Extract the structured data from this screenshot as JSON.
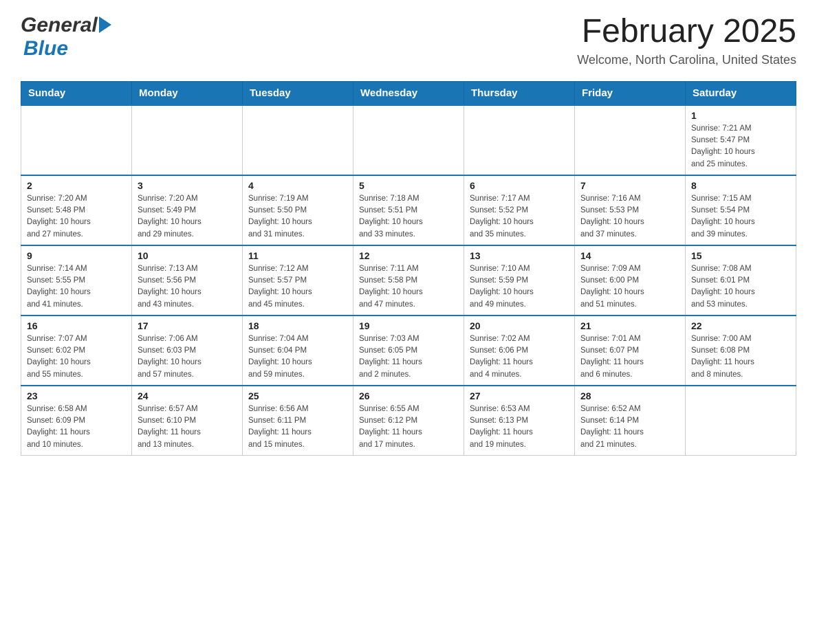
{
  "header": {
    "logo_general": "General",
    "logo_blue": "Blue",
    "title": "February 2025",
    "subtitle": "Welcome, North Carolina, United States"
  },
  "weekdays": [
    "Sunday",
    "Monday",
    "Tuesday",
    "Wednesday",
    "Thursday",
    "Friday",
    "Saturday"
  ],
  "weeks": [
    [
      {
        "day": "",
        "info": ""
      },
      {
        "day": "",
        "info": ""
      },
      {
        "day": "",
        "info": ""
      },
      {
        "day": "",
        "info": ""
      },
      {
        "day": "",
        "info": ""
      },
      {
        "day": "",
        "info": ""
      },
      {
        "day": "1",
        "info": "Sunrise: 7:21 AM\nSunset: 5:47 PM\nDaylight: 10 hours\nand 25 minutes."
      }
    ],
    [
      {
        "day": "2",
        "info": "Sunrise: 7:20 AM\nSunset: 5:48 PM\nDaylight: 10 hours\nand 27 minutes."
      },
      {
        "day": "3",
        "info": "Sunrise: 7:20 AM\nSunset: 5:49 PM\nDaylight: 10 hours\nand 29 minutes."
      },
      {
        "day": "4",
        "info": "Sunrise: 7:19 AM\nSunset: 5:50 PM\nDaylight: 10 hours\nand 31 minutes."
      },
      {
        "day": "5",
        "info": "Sunrise: 7:18 AM\nSunset: 5:51 PM\nDaylight: 10 hours\nand 33 minutes."
      },
      {
        "day": "6",
        "info": "Sunrise: 7:17 AM\nSunset: 5:52 PM\nDaylight: 10 hours\nand 35 minutes."
      },
      {
        "day": "7",
        "info": "Sunrise: 7:16 AM\nSunset: 5:53 PM\nDaylight: 10 hours\nand 37 minutes."
      },
      {
        "day": "8",
        "info": "Sunrise: 7:15 AM\nSunset: 5:54 PM\nDaylight: 10 hours\nand 39 minutes."
      }
    ],
    [
      {
        "day": "9",
        "info": "Sunrise: 7:14 AM\nSunset: 5:55 PM\nDaylight: 10 hours\nand 41 minutes."
      },
      {
        "day": "10",
        "info": "Sunrise: 7:13 AM\nSunset: 5:56 PM\nDaylight: 10 hours\nand 43 minutes."
      },
      {
        "day": "11",
        "info": "Sunrise: 7:12 AM\nSunset: 5:57 PM\nDaylight: 10 hours\nand 45 minutes."
      },
      {
        "day": "12",
        "info": "Sunrise: 7:11 AM\nSunset: 5:58 PM\nDaylight: 10 hours\nand 47 minutes."
      },
      {
        "day": "13",
        "info": "Sunrise: 7:10 AM\nSunset: 5:59 PM\nDaylight: 10 hours\nand 49 minutes."
      },
      {
        "day": "14",
        "info": "Sunrise: 7:09 AM\nSunset: 6:00 PM\nDaylight: 10 hours\nand 51 minutes."
      },
      {
        "day": "15",
        "info": "Sunrise: 7:08 AM\nSunset: 6:01 PM\nDaylight: 10 hours\nand 53 minutes."
      }
    ],
    [
      {
        "day": "16",
        "info": "Sunrise: 7:07 AM\nSunset: 6:02 PM\nDaylight: 10 hours\nand 55 minutes."
      },
      {
        "day": "17",
        "info": "Sunrise: 7:06 AM\nSunset: 6:03 PM\nDaylight: 10 hours\nand 57 minutes."
      },
      {
        "day": "18",
        "info": "Sunrise: 7:04 AM\nSunset: 6:04 PM\nDaylight: 10 hours\nand 59 minutes."
      },
      {
        "day": "19",
        "info": "Sunrise: 7:03 AM\nSunset: 6:05 PM\nDaylight: 11 hours\nand 2 minutes."
      },
      {
        "day": "20",
        "info": "Sunrise: 7:02 AM\nSunset: 6:06 PM\nDaylight: 11 hours\nand 4 minutes."
      },
      {
        "day": "21",
        "info": "Sunrise: 7:01 AM\nSunset: 6:07 PM\nDaylight: 11 hours\nand 6 minutes."
      },
      {
        "day": "22",
        "info": "Sunrise: 7:00 AM\nSunset: 6:08 PM\nDaylight: 11 hours\nand 8 minutes."
      }
    ],
    [
      {
        "day": "23",
        "info": "Sunrise: 6:58 AM\nSunset: 6:09 PM\nDaylight: 11 hours\nand 10 minutes."
      },
      {
        "day": "24",
        "info": "Sunrise: 6:57 AM\nSunset: 6:10 PM\nDaylight: 11 hours\nand 13 minutes."
      },
      {
        "day": "25",
        "info": "Sunrise: 6:56 AM\nSunset: 6:11 PM\nDaylight: 11 hours\nand 15 minutes."
      },
      {
        "day": "26",
        "info": "Sunrise: 6:55 AM\nSunset: 6:12 PM\nDaylight: 11 hours\nand 17 minutes."
      },
      {
        "day": "27",
        "info": "Sunrise: 6:53 AM\nSunset: 6:13 PM\nDaylight: 11 hours\nand 19 minutes."
      },
      {
        "day": "28",
        "info": "Sunrise: 6:52 AM\nSunset: 6:14 PM\nDaylight: 11 hours\nand 21 minutes."
      },
      {
        "day": "",
        "info": ""
      }
    ]
  ]
}
